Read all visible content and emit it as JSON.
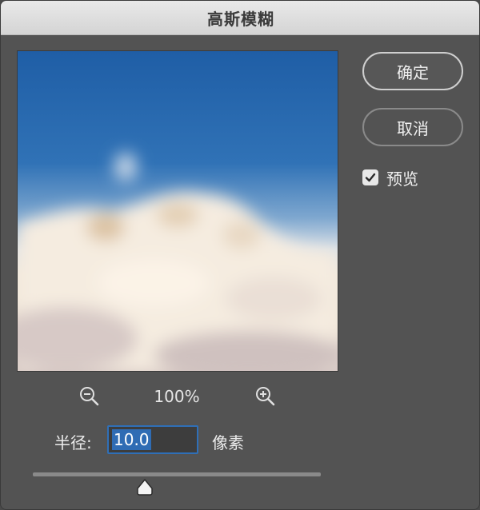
{
  "dialog": {
    "title": "高斯模糊"
  },
  "buttons": {
    "ok_label": "确定",
    "cancel_label": "取消"
  },
  "preview_toggle": {
    "label": "预览",
    "checked": true
  },
  "zoom": {
    "level": "100%"
  },
  "radius": {
    "label": "半径:",
    "value": "10.0",
    "unit": "像素",
    "slider_fraction": 0.39
  },
  "icons": {
    "zoom_out": "zoom-out-icon",
    "zoom_in": "zoom-in-icon",
    "check": "checkmark-icon",
    "slider": "slider-thumb-icon"
  },
  "colors": {
    "panel": "#535353",
    "titlebar": "#dcdcdc",
    "accent": "#2f6cb4",
    "sky": "#1f5ea6"
  }
}
